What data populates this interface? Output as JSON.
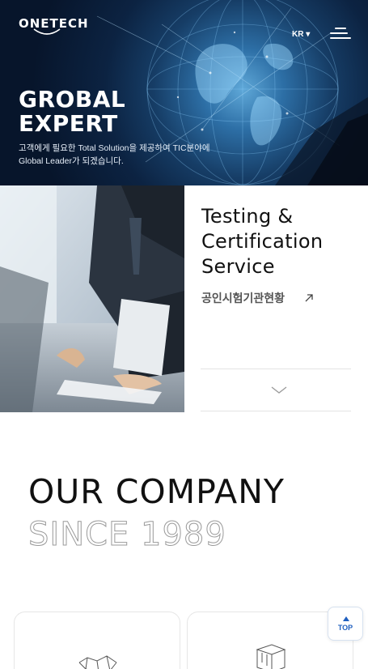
{
  "header": {
    "logo_text": "ONETECH",
    "language": "KR",
    "menu_icon": "hamburger-menu-icon"
  },
  "hero": {
    "title_line1": "GROBAL",
    "title_line2": "EXPERT",
    "subtitle": "고객에게 필요한 Total Solution을 제공하여 TIC분야에 Global Leader가 되겠습니다."
  },
  "service": {
    "title_line1": "Testing &",
    "title_line2": "Certification",
    "title_line3": "Service",
    "link_label": "공인시험기관현황",
    "link_icon": "arrow-up-right-icon",
    "scroll_icon": "chevron-down-icon"
  },
  "company": {
    "title": "OUR COMPANY",
    "since": "SINCE 1989"
  },
  "cards": [
    {
      "icon": "network-icon"
    },
    {
      "icon": "cube-icon"
    }
  ],
  "top_button": {
    "label": "TOP",
    "icon": "triangle-up-icon"
  },
  "colors": {
    "hero_bg": "#0c2342",
    "accent_blue": "#1f5fbf",
    "text_dark": "#111111"
  }
}
